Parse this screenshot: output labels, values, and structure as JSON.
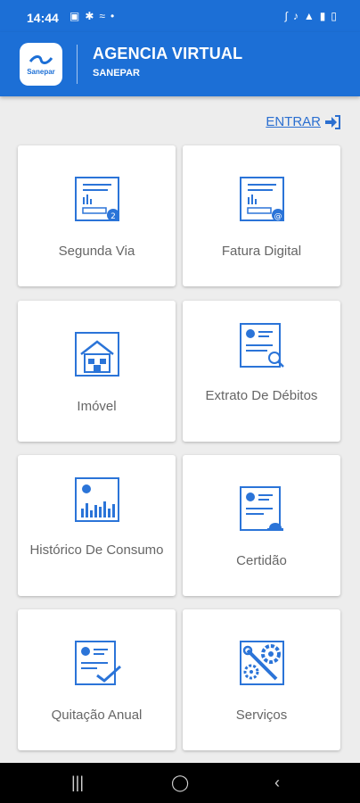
{
  "status": {
    "time": "14:44",
    "left_icons": [
      "laptop-icon",
      "pinwheel-icon",
      "cast-icon",
      "dot-icon"
    ],
    "right_icons": [
      "bluetooth-icon",
      "mute-icon",
      "wifi-icon",
      "signal-icon",
      "battery-icon"
    ]
  },
  "header": {
    "logo_text": "Sanepar",
    "title": "AGENCIA VIRTUAL",
    "subtitle": "SANEPAR"
  },
  "login": {
    "label": "ENTRAR"
  },
  "cards": [
    {
      "label": "Segunda Via",
      "icon": "invoice-icon"
    },
    {
      "label": "Fatura Digital",
      "icon": "digital-invoice-icon"
    },
    {
      "label": "Imóvel",
      "icon": "house-icon"
    },
    {
      "label": "Extrato De Débitos",
      "icon": "statement-search-icon"
    },
    {
      "label": "Histórico De Consumo",
      "icon": "consumption-chart-icon"
    },
    {
      "label": "Certidão",
      "icon": "certificate-icon"
    },
    {
      "label": "Quitação Anual",
      "icon": "annual-payment-icon"
    },
    {
      "label": "Serviços",
      "icon": "services-icon"
    }
  ],
  "colors": {
    "primary": "#1c6fd6",
    "icon_blue": "#2b74d8",
    "card_text": "#666666"
  }
}
